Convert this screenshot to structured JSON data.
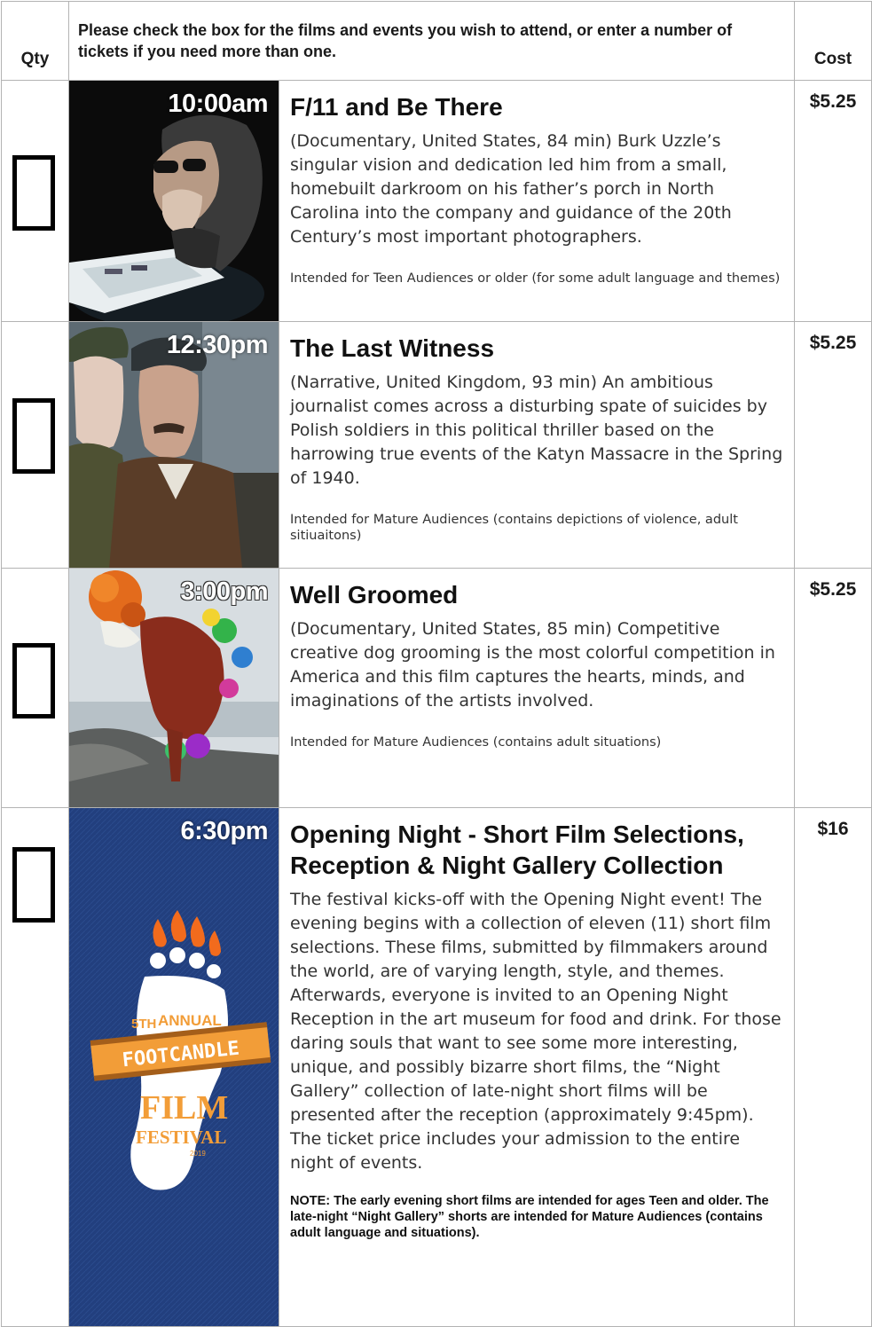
{
  "header": {
    "qty_label": "Qty",
    "instructions": "Please check the box for the films and events you wish to attend, or enter a number of tickets if you need more than one.",
    "cost_label": "Cost"
  },
  "films": [
    {
      "time": "10:00am",
      "title": "F/11 and Be There",
      "description": "(Documentary, United States, 84 min)  Burk Uzzle’s singular vision and dedication led him from a small, homebuilt darkroom on his father’s porch in North Carolina into the company and guidance of the 20th Century’s most important photographers.",
      "note": "Intended for Teen Audiences or older (for some adult language and themes)",
      "cost": "$5.25"
    },
    {
      "time": "12:30pm",
      "title": "The Last Witness",
      "description": "(Narrative, United Kingdom, 93 min) An ambitious journalist comes across a disturbing spate of suicides by Polish soldiers in this political thriller based on the harrowing true events of the Katyn Massacre in the Spring of 1940.",
      "note": "Intended for Mature Audiences (contains depictions of violence, adult sitiuaitons)",
      "cost": "$5.25"
    },
    {
      "time": "3:00pm",
      "title": "Well Groomed",
      "description": "(Documentary, United States, 85 min) Competitive creative dog grooming is the most colorful competition in America and this film captures the hearts, minds, and imaginations of the artists involved.",
      "note": "Intended for Mature Audiences (contains adult situations)",
      "cost": "$5.25"
    },
    {
      "time": "6:30pm",
      "title": "Opening Night - Short Film Selections, Reception & Night Gallery Collection",
      "description": "The festival kicks-off with the Opening Night event!  The evening begins with a collection of eleven (11) short film selections.  These films, submitted by filmmakers around the world, are of varying length, style, and themes.  Afterwards, everyone is invited to an Opening Night Reception in the art museum for food and drink.  For those daring souls that want to see some more interesting, unique, and possibly bizarre short films, the “Night Gallery” collection of late-night short films will be presented after the reception (approximately 9:45pm). The ticket price includes your admission to the entire night of events.",
      "note": "NOTE: The early evening short films are intended for ages Teen and older.  The late-night “Night Gallery” shorts are intended for Mature Audiences (contains adult language and situations).",
      "cost": "$16",
      "poster_text": {
        "edition": "5TH",
        "annual": "ANNUAL",
        "name": "FOOTCANDLE",
        "film": "FILM",
        "festival": "FESTIVAL",
        "year": "2019"
      }
    }
  ],
  "colors": {
    "checkbox_border": "#000000",
    "grid_border": "#b3b3b3",
    "poster_navy": "#223f7e",
    "festival_orange": "#f29d38"
  }
}
